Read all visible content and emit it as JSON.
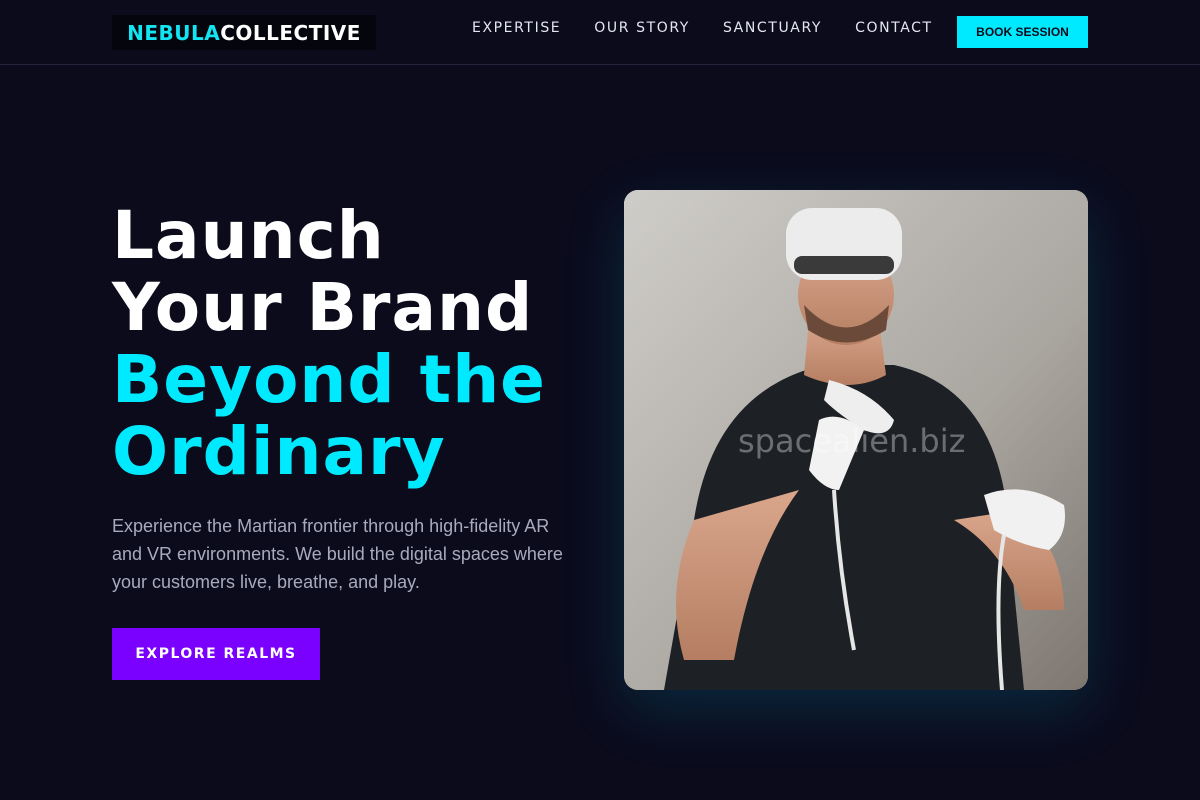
{
  "logo": {
    "part1": "NEBULA",
    "part2": "COLLECTIVE"
  },
  "nav": {
    "links": [
      "EXPERTISE",
      "OUR STORY",
      "SANCTUARY",
      "CONTACT"
    ],
    "cta": "BOOK SESSION"
  },
  "hero": {
    "headline_white": [
      "Launch",
      "Your Brand"
    ],
    "headline_cyan": [
      "Beyond the",
      "Ordinary"
    ],
    "description": "Experience the Martian frontier through high-fidelity AR and VR environments. We build the digital spaces where your customers live, breathe, and play.",
    "cta": "EXPLORE REALMS",
    "image_watermark": "spacealien.biz"
  },
  "colors": {
    "background": "#0b0b1c",
    "accent_cyan": "#00eaff",
    "accent_purple": "#7a00ff"
  }
}
